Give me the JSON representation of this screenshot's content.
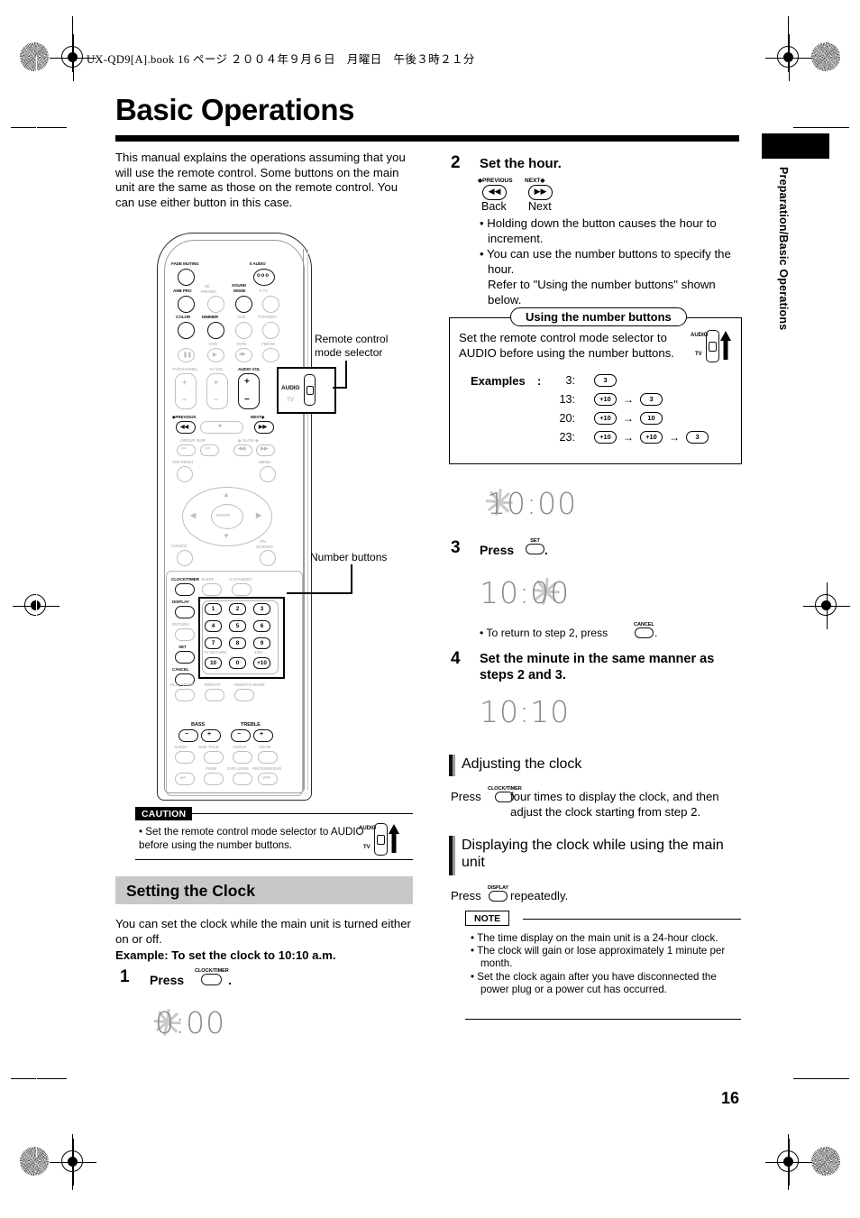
{
  "header": {
    "book_line": "UX-QD9[A].book   16 ページ  ２００４年９月６日　月曜日　午後３時２１分"
  },
  "page": {
    "title": "Basic Operations",
    "number": "16",
    "side_tab_label": "Preparation/Basic Operations"
  },
  "intro": {
    "text": "This manual explains the operations assuming that you will use the remote control. Some buttons on the main unit are the same as those on the remote control. You can use either button in this case."
  },
  "remote": {
    "callout_mode_selector": "Remote control\nmode selector",
    "callout_number_buttons": "Number buttons",
    "labels": {
      "fade_muting": "FADE MUTING",
      "standby_audio": "/I  AUDIO",
      "ahb_pro": "AHB PRO",
      "phonic_3d": "3D\nPHONIC",
      "sound_mode": "SOUND\nMODE",
      "standby_tv": "/I TV",
      "color": "COLOR",
      "dimmer": "DIMMER",
      "aux": "AUX",
      "tv_video": "TV/VIDEO",
      "dvd": "DVD",
      "tape": "TAPE",
      "fm_am": "FM/AM",
      "tv_channel": "TV/CHANNEL",
      "tv_vol": "TV VOL",
      "audio_vol": "AUDIO VOL",
      "previous": "PREVIOUS",
      "next": "NEXT",
      "group_skip": "GROUP SKIP",
      "slow": "SLOW",
      "top_menu": "TOP MENU",
      "menu": "MENU",
      "enter": "ENTER",
      "choice": "CHOICE",
      "on_screen": "ON\nSCREEN",
      "clock_timer": "CLOCK/TIMER",
      "sleep": "SLEEP",
      "a_standby": "A.STANDBY",
      "display": "DISPLAY",
      "return": "RETURN",
      "set": "SET",
      "cancel": "CANCEL",
      "tv_return": "TV RETURN",
      "hundred_plus": "100+",
      "play_mode": "PLAY MODE",
      "repeat": "REPEAT",
      "remote_mode": "REMOTE MODE",
      "bass": "BASS",
      "treble": "TREBLE",
      "audio": "AUDIO",
      "sub_title": "SUB TITLE",
      "angle": "ANGLE",
      "zoom": "ZOOM",
      "page": "PAGE",
      "dvd_level": "DVD LEVEL",
      "progressive": "PROGRESSIVE",
      "vfp": "VFP",
      "selector_audio": "AUDIO",
      "selector_tv": "TV"
    },
    "number_keys": [
      "1",
      "2",
      "3",
      "4",
      "5",
      "6",
      "7",
      "8",
      "9",
      "10",
      "0",
      "+10"
    ]
  },
  "caution": {
    "tag": "CAUTION",
    "text": "• Set the remote control mode selector to AUDIO before using the number buttons.",
    "selector_audio": "AUDIO",
    "selector_tv": "TV"
  },
  "setting_clock": {
    "heading": "Setting the Clock",
    "intro": "You can set the clock while the main unit is turned either on or off.",
    "example": "Example: To set the clock to 10:10 a.m.",
    "step1_num": "1",
    "step1_text": "Press",
    "step1_button": "CLOCK/TIMER",
    "step1_period": ".",
    "step1_display": "0:00"
  },
  "step2": {
    "num": "2",
    "heading": "Set the hour.",
    "prev_label": "PREVIOUS",
    "next_label": "NEXT",
    "back_label": "Back",
    "next_text": "Next",
    "bullets": [
      "• Holding down the button causes the hour to increment.",
      "• You can use the number buttons to specify the hour.",
      "Refer to \"Using the number buttons\" shown below."
    ]
  },
  "numberbox": {
    "title": "Using the number buttons",
    "text": "Set the remote control mode selector to AUDIO before using the number buttons.",
    "selector_audio": "AUDIO",
    "selector_tv": "TV",
    "examples_label": "Examples",
    "examples": [
      {
        "value": "3:",
        "keys": [
          "3"
        ]
      },
      {
        "value": "13:",
        "keys": [
          "+10",
          "3"
        ]
      },
      {
        "value": "20:",
        "keys": [
          "+10",
          "10"
        ]
      },
      {
        "value": "23:",
        "keys": [
          "+10",
          "+10",
          "3"
        ]
      }
    ]
  },
  "displays": {
    "after_step2": "10:00",
    "after_step3": "10:00",
    "after_step4": "10:10"
  },
  "step3": {
    "num": "3",
    "text": "Press",
    "button": "SET",
    "period": ".",
    "bullet": "• To return to step 2, press",
    "bullet_button": "CANCEL",
    "bullet_period": "."
  },
  "step4": {
    "num": "4",
    "heading": "Set the minute in the same manner as steps 2 and 3."
  },
  "adjusting": {
    "heading": "Adjusting the clock",
    "press": "Press",
    "button": "CLOCK/TIMER",
    "text": "four times to display the clock, and then adjust the clock starting from step 2."
  },
  "displaying": {
    "heading": "Displaying the clock while using the main unit",
    "press": "Press",
    "button": "DISPLAY",
    "text": "repeatedly."
  },
  "note": {
    "tag": "NOTE",
    "items": [
      "• The time display on the main unit is a 24-hour clock.",
      "• The clock will gain or lose approximately 1 minute per month.",
      "• Set the clock again after you have disconnected the power plug or a power cut has occurred."
    ]
  }
}
